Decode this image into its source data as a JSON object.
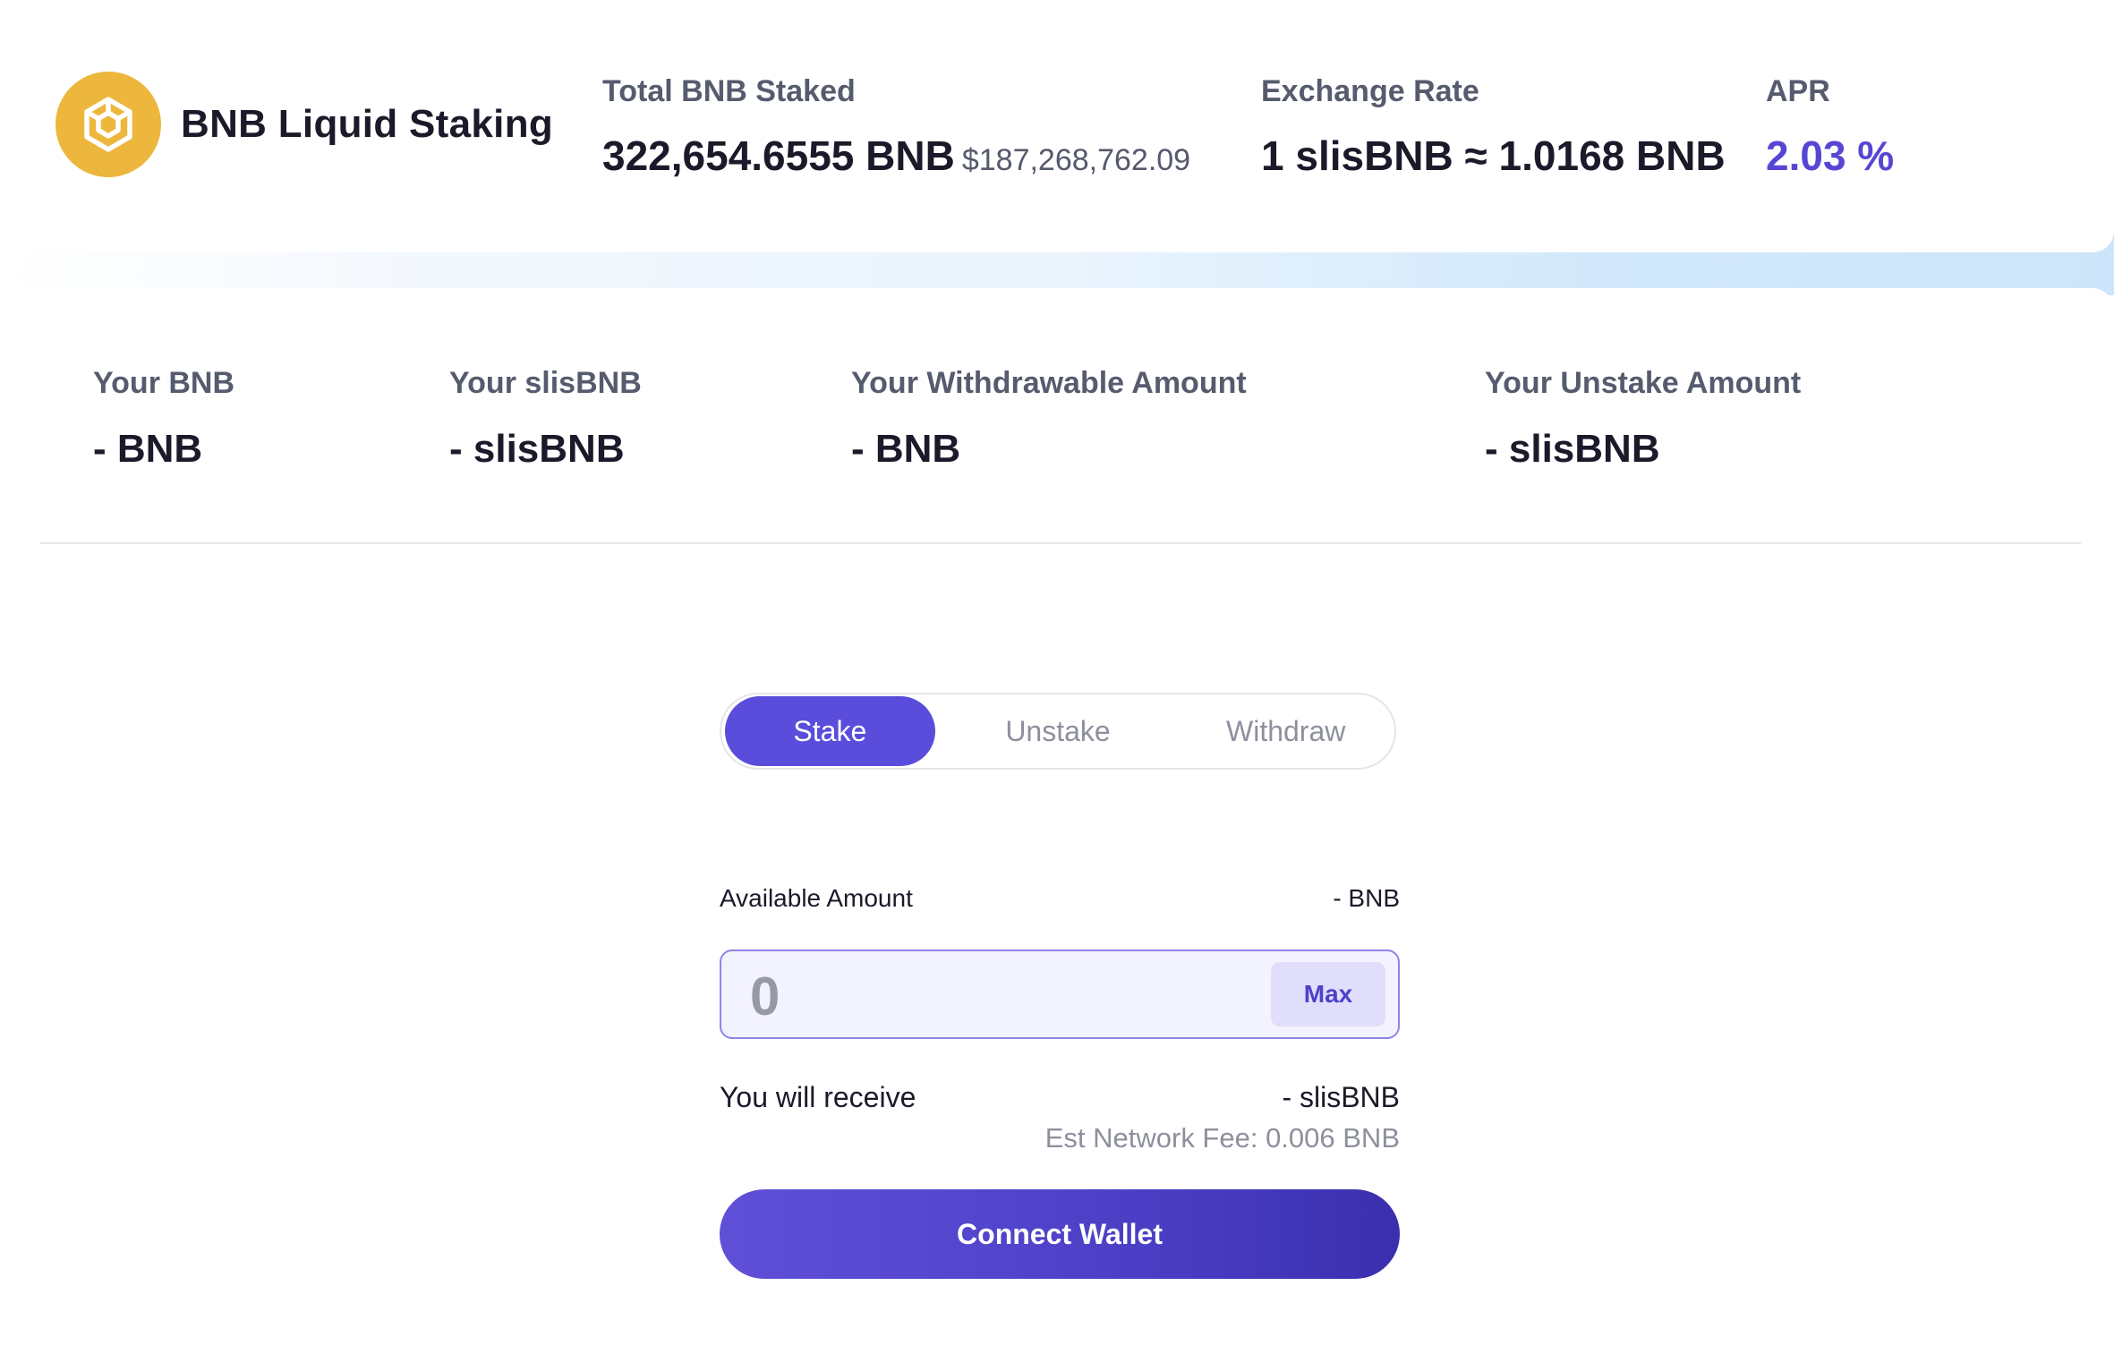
{
  "brand": {
    "name": "BNB Liquid Staking",
    "logo_icon": "bnb-logo-icon",
    "logo_color": "#EDB73D"
  },
  "stats": {
    "total_staked": {
      "label": "Total BNB Staked",
      "value": "322,654.6555 BNB",
      "usd": "$187,268,762.09"
    },
    "exchange_rate": {
      "label": "Exchange Rate",
      "value": "1 slisBNB ≈ 1.0168 BNB"
    },
    "apr": {
      "label": "APR",
      "value": "2.03 %",
      "color": "#5746D4"
    }
  },
  "balances": [
    {
      "label": "Your BNB",
      "value": "- BNB"
    },
    {
      "label": "Your slisBNB",
      "value": "- slisBNB"
    },
    {
      "label": "Your Withdrawable Amount",
      "value": "- BNB"
    },
    {
      "label": "Your Unstake Amount",
      "value": "- slisBNB"
    }
  ],
  "widget": {
    "tabs": [
      {
        "label": "Stake",
        "active": true
      },
      {
        "label": "Unstake",
        "active": false
      },
      {
        "label": "Withdraw",
        "active": false
      }
    ],
    "available": {
      "label": "Available Amount",
      "value": "- BNB"
    },
    "amount_input": {
      "value": "",
      "placeholder": "0"
    },
    "max_label": "Max",
    "receive": {
      "label": "You will receive",
      "value": "- slisBNB"
    },
    "fee": "Est Network Fee: 0.006 BNB",
    "connect_label": "Connect Wallet",
    "accent_color": "#5A4DDC"
  }
}
